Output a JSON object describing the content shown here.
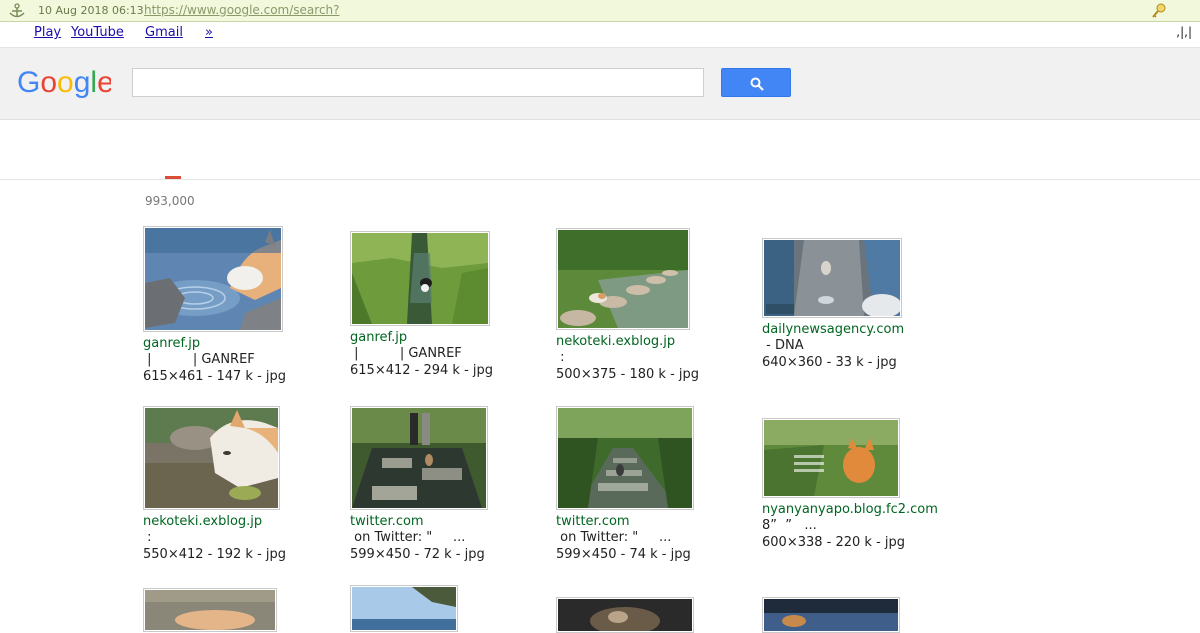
{
  "topbar": {
    "date": "10 Aug 2018 06:13",
    "url": "https://www.google.com/search?"
  },
  "nav": {
    "links": [
      "Play",
      "YouTube",
      "Gmail",
      "»"
    ],
    "right_text": ",|,|"
  },
  "search": {
    "value": "",
    "placeholder": ""
  },
  "results": {
    "count": "993,000",
    "items": [
      {
        "domain": "ganref.jp",
        "desc": " |          | GANREF",
        "meta": "615×461 - 147 k - jpg"
      },
      {
        "domain": "ganref.jp",
        "desc": " |          | GANREF",
        "meta": "615×412 - 294 k - jpg"
      },
      {
        "domain": "nekoteki.exblog.jp",
        "desc": " :",
        "meta": "500×375 - 180 k - jpg"
      },
      {
        "domain": "dailynewsagency.com",
        "desc": " - DNA",
        "meta": "640×360 - 33 k - jpg"
      },
      {
        "domain": "nekoteki.exblog.jp",
        "desc": " :",
        "meta": "550×412 - 192 k - jpg"
      },
      {
        "domain": "twitter.com",
        "desc": " on Twitter: \"     ...",
        "meta": "599×450 - 72 k - jpg"
      },
      {
        "domain": "twitter.com",
        "desc": " on Twitter: \"     ...",
        "meta": "599×450 - 74 k - jpg"
      },
      {
        "domain": "nyanyanyapo.blog.fc2.com",
        "desc": "8”  ”   ...",
        "meta": "600×338 - 220 k - jpg"
      }
    ]
  },
  "colors": {
    "link": "#1a0dab",
    "domain_green": "#006621",
    "search_blue": "#4285f4",
    "tab_red": "#dd4b39",
    "topbar_bg": "#f1f8dc"
  }
}
